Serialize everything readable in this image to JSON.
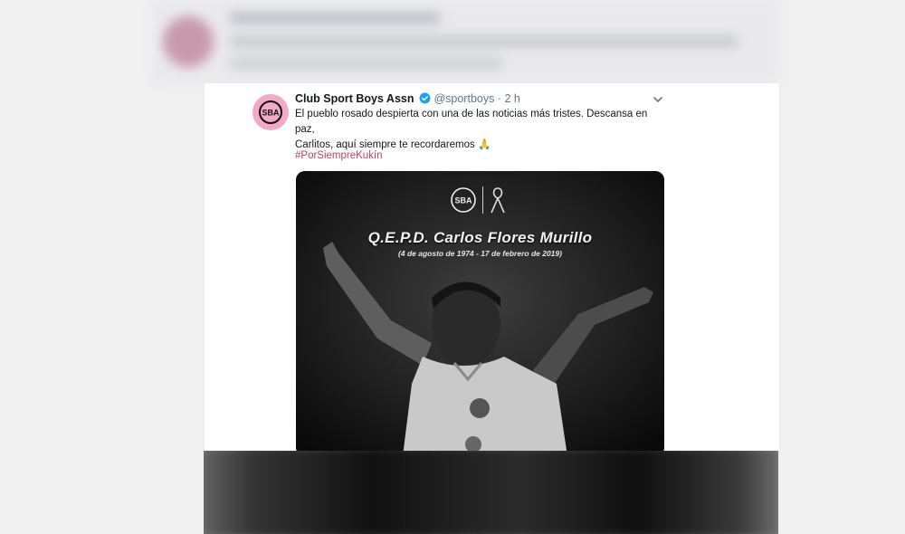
{
  "tweet": {
    "name": "Club Sport Boys Assn",
    "handle": "@sportboys",
    "separator": "·",
    "time": "2 h",
    "text_line1": "El pueblo rosado despierta con una de las noticias más tristes. Descansa en paz,",
    "text_line2": "Carlitos, aquí siempre te recordaremos",
    "emoji": "🙏",
    "hashtag": "#PorSiempreKukín"
  },
  "media": {
    "logo_text": "SBA",
    "title": "Q.E.P.D. Carlos Flores Murillo",
    "dates": "(4 de agosto de 1974 - 17 de febrero de 2019)"
  },
  "colors": {
    "avatar_bg": "#f1a9c6",
    "hashtag": "#b93f6b",
    "verified": "#1da1f2"
  },
  "icons": [
    "sba-logo-icon",
    "verified-badge-icon",
    "chevron-down-icon",
    "mourning-ribbon-icon"
  ]
}
